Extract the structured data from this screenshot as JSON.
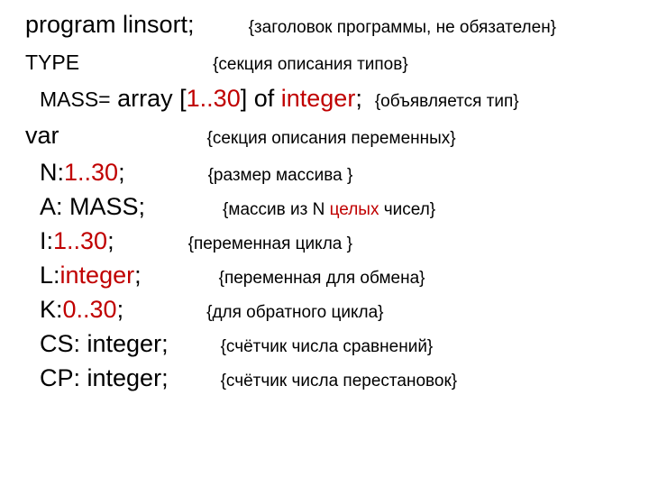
{
  "l1": {
    "code_a": "program linsort;",
    "comment": "{заголовок программы, не обязателен}"
  },
  "l2": {
    "code_a": "TYPE",
    "comment": "{секция описания типов}"
  },
  "l3": {
    "code_a": "MASS=",
    "code_b": " array [",
    "hl_a": "1..30",
    "code_c": "] of ",
    "hl_b": "integer",
    "code_d": ";",
    "comment": "{объявляется  тип}"
  },
  "l4": {
    "code_a": "var",
    "comment": "{секция описания переменных}"
  },
  "l5": {
    "code_a": "N:",
    "hl_a": "1..30",
    "code_b": ";",
    "comment": "{размер массива }"
  },
  "l6": {
    "code_a": "A: MASS;",
    "c1": "{массив из N ",
    "hl_a": "целых",
    "c2": " чисел}"
  },
  "l7": {
    "code_a": "I:",
    "hl_a": "1..30",
    "code_b": ";",
    "comment": "{переменная цикла  }"
  },
  "l8": {
    "code_a": "L:",
    "hl_a": "integer",
    "code_b": ";",
    "comment": "{переменная для обмена}"
  },
  "l9": {
    "code_a": "K:",
    "hl_a": "0..30",
    "code_b": ";",
    "comment": "{для обратного цикла}"
  },
  "l10": {
    "code_a": "CS: integer;",
    "comment": "{счётчик числа сравнений}"
  },
  "l11": {
    "code_a": "CP: integer;",
    "comment": "{счётчик числа перестановок}"
  }
}
